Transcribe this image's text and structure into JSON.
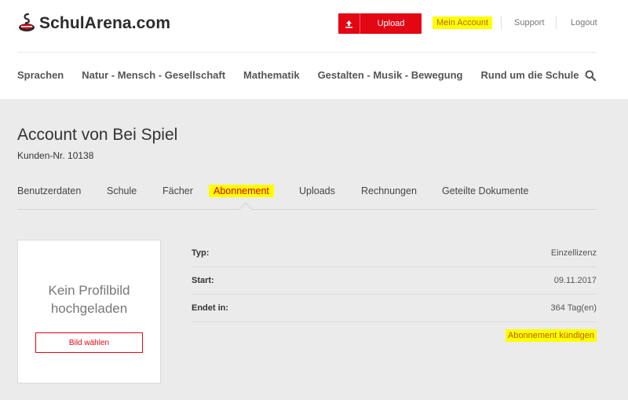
{
  "header": {
    "logo_text": "SchulArena",
    "logo_suffix": ".com",
    "upload_label": "Upload",
    "links": {
      "mein_account": "Mein Account",
      "support": "Support",
      "logout": "Logout"
    }
  },
  "nav": {
    "items": [
      "Sprachen",
      "Natur - Mensch - Gesellschaft",
      "Mathematik",
      "Gestalten - Musik - Bewegung",
      "Rund um die Schule"
    ]
  },
  "account": {
    "title": "Account von Bei Spiel",
    "kunden_nr": "Kunden-Nr. 10138"
  },
  "tabs": [
    "Benutzerdaten",
    "Schule",
    "Fächer",
    "Abonnement",
    "Uploads",
    "Rechnungen",
    "Geteilte Dokumente"
  ],
  "profile": {
    "no_picture_line1": "Kein Profilbild",
    "no_picture_line2": "hochgeladen",
    "choose_button": "Bild wählen"
  },
  "subscription": {
    "rows": [
      {
        "key": "Typ:",
        "value": "Einzellizenz"
      },
      {
        "key": "Start:",
        "value": "09.11.2017"
      },
      {
        "key": "Endet in:",
        "value": "364 Tag(en)"
      }
    ],
    "cancel_link": "Abonnement kündigen"
  },
  "colors": {
    "brand_red": "#e30613",
    "highlight": "#ffff00"
  }
}
